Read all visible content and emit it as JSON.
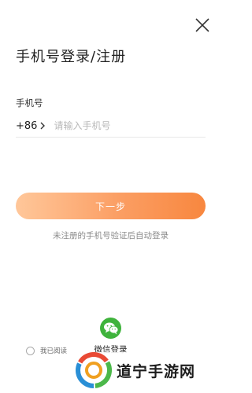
{
  "header": {
    "title": "手机号登录/注册",
    "close_icon": "close-icon"
  },
  "form": {
    "phone_label": "手机号",
    "country_code": "+86",
    "phone_placeholder": "请输入手机号",
    "phone_value": ""
  },
  "actions": {
    "next_label": "下一步",
    "hint": "未注册的手机号验证后自动登录"
  },
  "social": {
    "wechat_label": "微信登录",
    "wechat_icon": "wechat-icon"
  },
  "agreement": {
    "text": "我已阅读"
  },
  "watermark": {
    "text": "道宁手游网"
  },
  "colors": {
    "accent_start": "#ffc79a",
    "accent_end": "#f8873f",
    "wechat_green": "#3fb33c"
  }
}
